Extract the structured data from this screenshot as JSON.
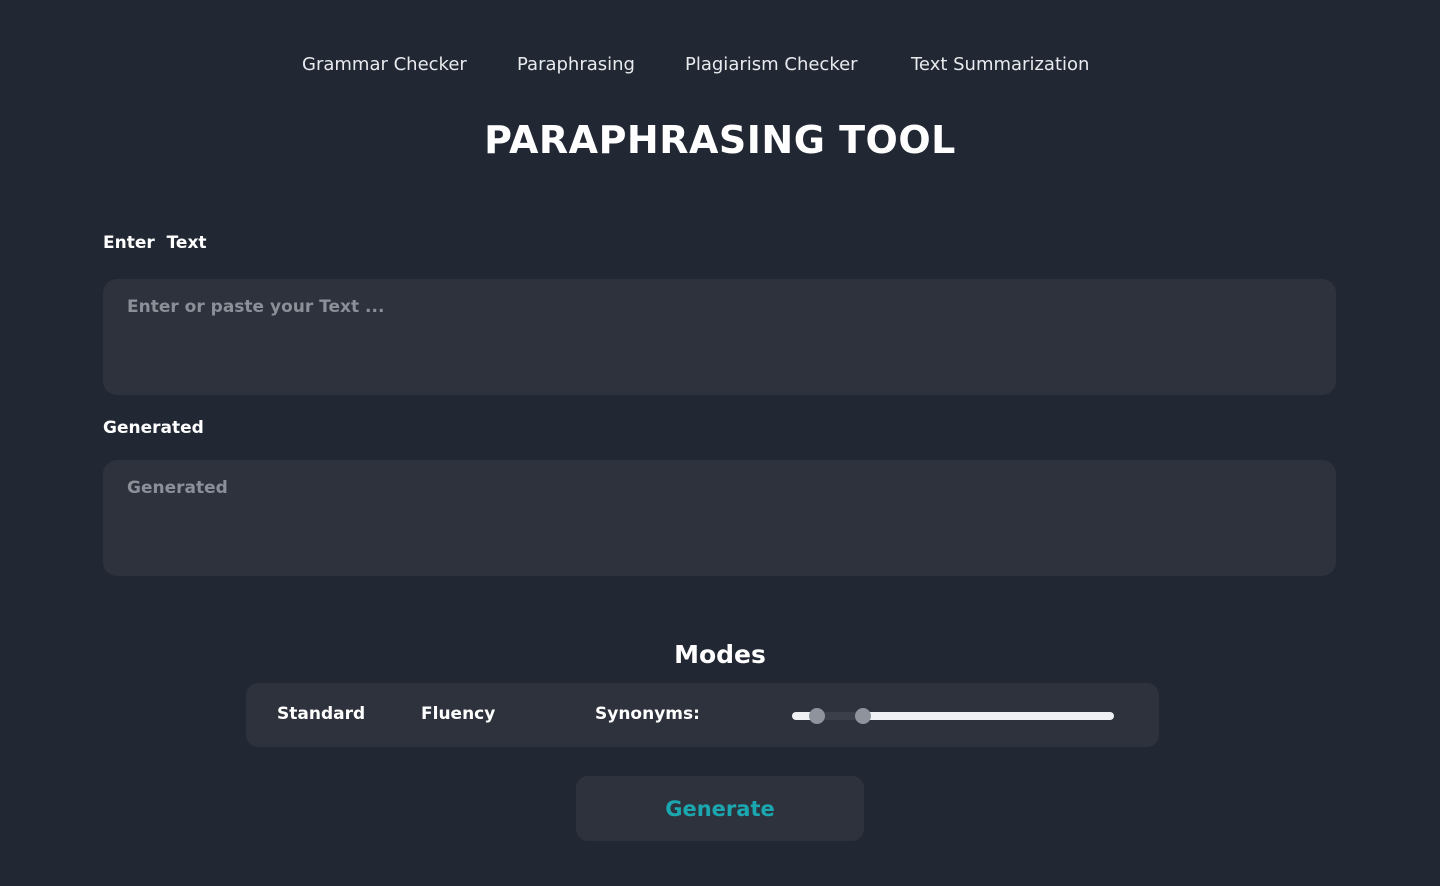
{
  "nav": {
    "items": [
      {
        "label": "Grammar Checker"
      },
      {
        "label": "Paraphrasing"
      },
      {
        "label": "Plagiarism Checker"
      },
      {
        "label": "Text Summarization"
      }
    ]
  },
  "page_title": "PARAPHRASING TOOL",
  "input_section": {
    "label": "Enter  Text",
    "value": "",
    "placeholder": "Enter or paste your Text ..."
  },
  "output_section": {
    "label": "Generated",
    "value": "",
    "placeholder": "Generated"
  },
  "modes": {
    "title": "Modes",
    "items": [
      {
        "label": "Standard"
      },
      {
        "label": "Fluency"
      }
    ],
    "synonyms_label": "Synonyms:"
  },
  "generate_button": {
    "label": "Generate"
  },
  "colors": {
    "page_background": "#222833",
    "panel_background": "#2e323c",
    "accent": "#1aa7b0",
    "placeholder_text": "#8b8f98"
  }
}
